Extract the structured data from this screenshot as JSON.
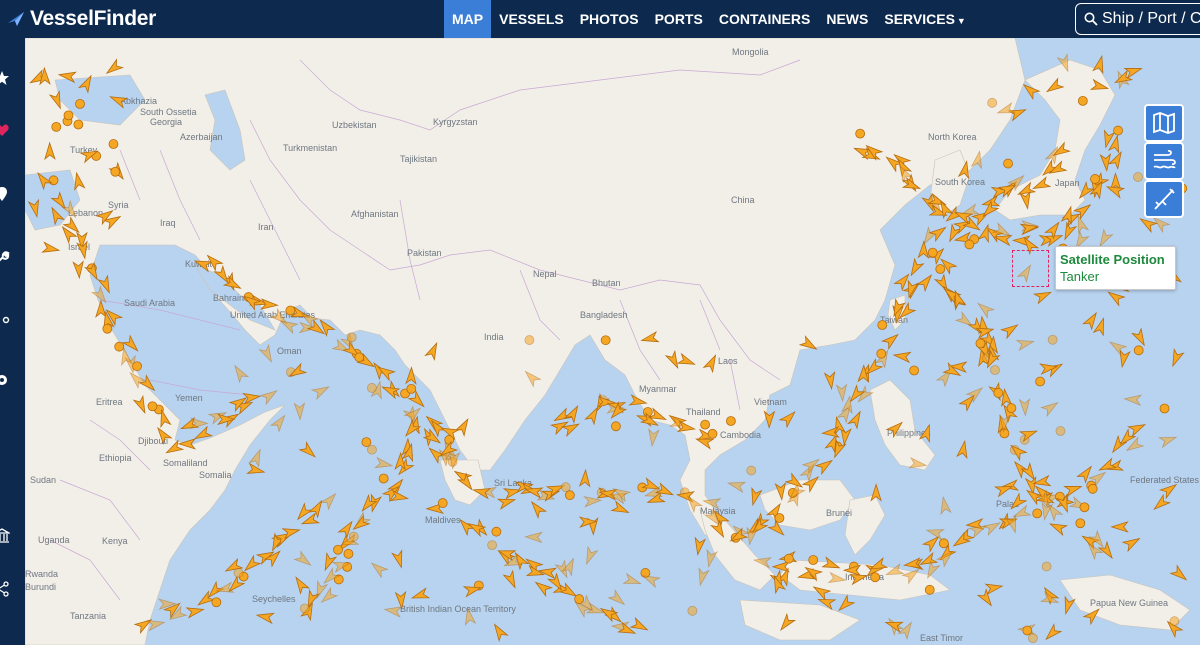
{
  "app": {
    "logo_text": "VesselFinder"
  },
  "nav": {
    "items": [
      "MAP",
      "VESSELS",
      "PHOTOS",
      "PORTS",
      "CONTAINERS",
      "NEWS",
      "SERVICES"
    ],
    "active": "MAP"
  },
  "search": {
    "placeholder": "Ship / Port / C"
  },
  "sidebar": {
    "icons": [
      "star-icon",
      "heart-icon",
      "map-pin-icon",
      "wrench-icon",
      "share-icon",
      "gear-icon",
      "bank-icon",
      "share-icon"
    ]
  },
  "map_controls": [
    "map-layers-icon",
    "wind-waves-icon",
    "measure-compass-icon"
  ],
  "tooltip": {
    "title": "Satellite Position",
    "subtitle": "Tanker"
  },
  "colors": {
    "header": "#0d2a4e",
    "active_tab": "#3b7ed7",
    "sea": "#b8d3ef",
    "land": "#f2efe9",
    "vessel": "#f5a623",
    "vessel_outline": "#b56d10",
    "tooltip_text": "#1d8a3d"
  },
  "map_labels": [
    "Mongolia",
    "Abkhazia",
    "South Ossetia",
    "Georgia",
    "Azerbaijan",
    "Uzbekistan",
    "Kyrgyzstan",
    "North Korea",
    "Turkey",
    "Turkmenistan",
    "Tajikistan",
    "South Korea",
    "Japan",
    "Syria",
    "Lebanon",
    "Iraq",
    "Afghanistan",
    "China",
    "Iran",
    "Israel",
    "Pakistan",
    "Nepal",
    "Kuwait",
    "Bhutan",
    "Saudi Arabia",
    "Bahrain",
    "United Arab Emirates",
    "Bangladesh",
    "Taiwan",
    "Oman",
    "India",
    "Laos",
    "Yemen",
    "Myanmar",
    "Eritrea",
    "Thailand",
    "Vietnam",
    "Cambodia",
    "Philippines",
    "Djibouti",
    "Ethiopia",
    "Somaliland",
    "Somalia",
    "Sudan",
    "Sri Lanka",
    "Malaysia",
    "Brunei",
    "Palau",
    "Federated States of Micronesia",
    "Maldives",
    "Uganda",
    "Kenya",
    "Indonesia",
    "Rwanda",
    "Burundi",
    "Seychelles",
    "Tanzania",
    "British Indian Ocean Territory",
    "Papua New Guinea",
    "East Timor"
  ]
}
